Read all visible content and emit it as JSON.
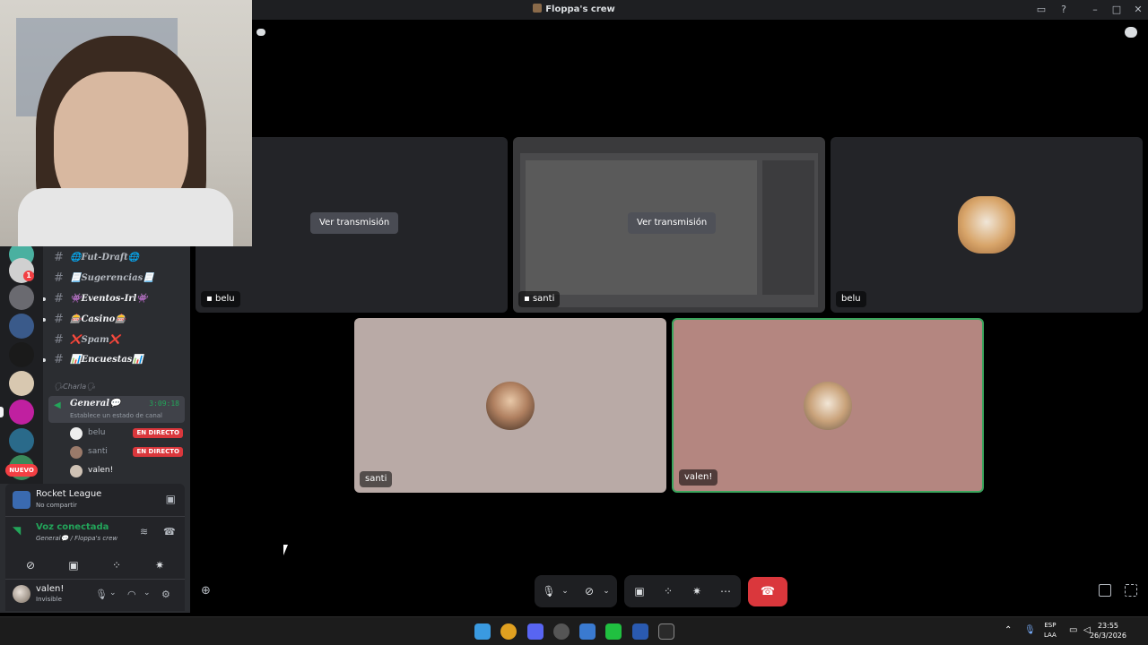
{
  "window": {
    "title": "Floppa's crew"
  },
  "sidebar": {
    "channels": [
      {
        "name": "🌐Fut-Draft🌐",
        "unread": false
      },
      {
        "name": "📃Sugerencias📃",
        "unread": false
      },
      {
        "name": "👾Eventos-Irl👾",
        "unread": true
      },
      {
        "name": "🎰Casino🎰",
        "unread": true
      },
      {
        "name": "❌Spam❌",
        "unread": false
      },
      {
        "name": "📊Encuestas📊",
        "unread": true
      }
    ],
    "category": "🗣Charla🗣",
    "voice_channel": {
      "name": "General💬",
      "time": "3:09:18",
      "status": "Establece un estado de canal"
    },
    "voice_users": [
      {
        "name": "belu",
        "live": "EN DIRECTO"
      },
      {
        "name": "santi",
        "live": "EN DIRECTO"
      },
      {
        "name": "valen!",
        "live": ""
      }
    ],
    "server_badge": "1",
    "new_badge": "NUEVO"
  },
  "activity": {
    "game": "Rocket League",
    "share": "No compartir"
  },
  "voice": {
    "title": "Voz conectada",
    "subtitle": "General💬 / Floppa's crew"
  },
  "user": {
    "name": "valen!",
    "status": "Invisible"
  },
  "tiles": {
    "stream1": {
      "label": "belu",
      "watch": "Ver transmisión"
    },
    "stream2": {
      "label": "santi",
      "watch": "Ver transmisión"
    },
    "belu": {
      "label": "belu"
    },
    "santi": {
      "label": "santi"
    },
    "valen": {
      "label": "valen!"
    }
  },
  "taskbar": {
    "lang1": "ESP",
    "lang2": "LAA",
    "time": "23:55",
    "date": "26/3/2026"
  },
  "colors": {
    "accent_green": "#23a55a",
    "danger": "#da373c",
    "tile_santi": "#b9aaa6",
    "tile_valen": "#b48680"
  }
}
